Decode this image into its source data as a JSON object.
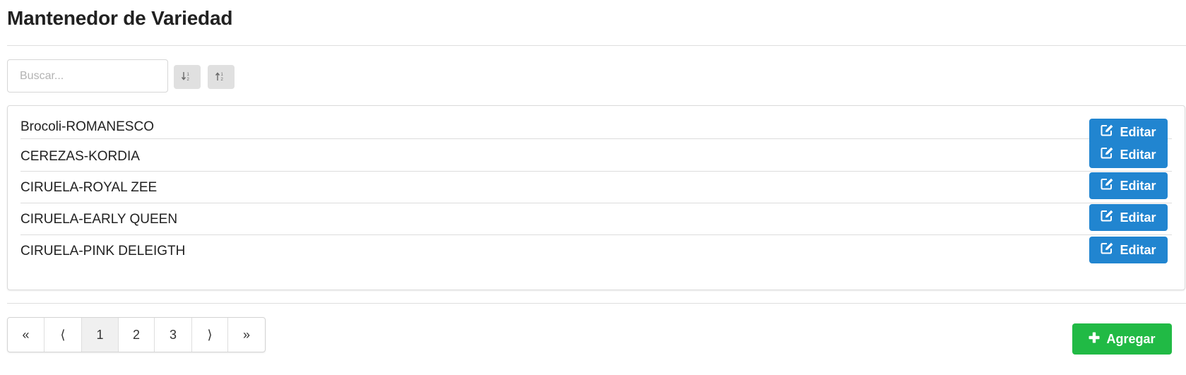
{
  "page": {
    "title": "Mantenedor de Variedad"
  },
  "search": {
    "placeholder": "Buscar...",
    "value": ""
  },
  "sort": {
    "ascending_icon": "sort-alpha-down-icon",
    "descending_icon": "sort-alpha-up-icon"
  },
  "list": {
    "items": [
      {
        "label": "Brocoli-ROMANESCO",
        "action_label": "Editar"
      },
      {
        "label": "CEREZAS-KORDIA",
        "action_label": "Editar"
      },
      {
        "label": "CIRUELA-ROYAL ZEE",
        "action_label": "Editar"
      },
      {
        "label": "CIRUELA-EARLY QUEEN",
        "action_label": "Editar"
      },
      {
        "label": "CIRUELA-PINK DELEIGTH",
        "action_label": "Editar"
      }
    ],
    "edit_icon": "edit-icon"
  },
  "pagination": {
    "first": "«",
    "prev": "⟨",
    "pages": [
      "1",
      "2",
      "3"
    ],
    "current_page": "1",
    "next": "⟩",
    "last": "»"
  },
  "actions": {
    "add_label": "Agregar",
    "add_icon": "plus-icon"
  },
  "colors": {
    "edit_button": "#2185d0",
    "add_button": "#21ba45",
    "sort_button": "#e0e0e0"
  }
}
